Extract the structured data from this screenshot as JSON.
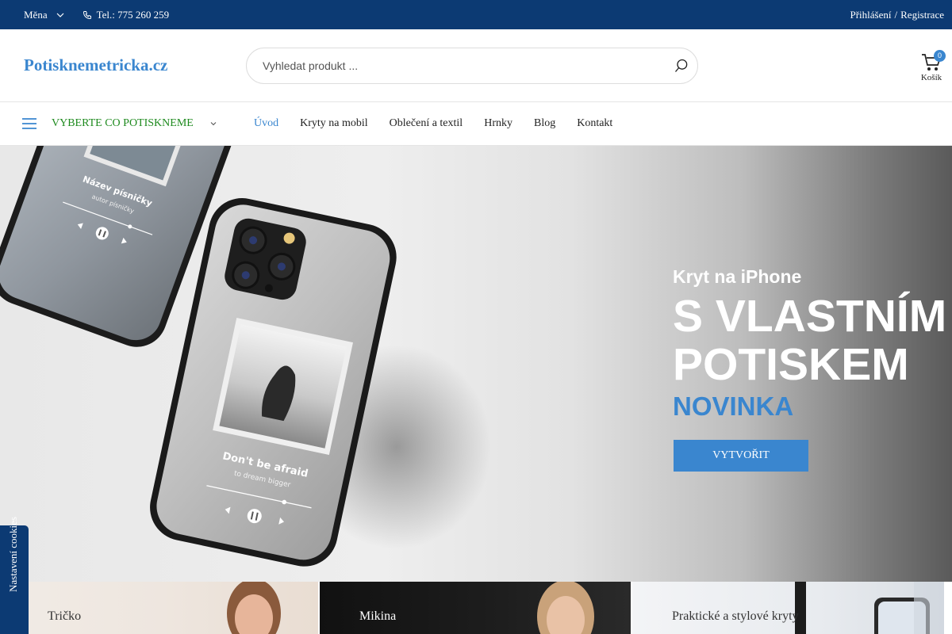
{
  "topbar": {
    "currency_label": "Měna",
    "phone_label": "Tel.: 775 260 259",
    "login_label": "Přihlášení",
    "separator": "/",
    "register_label": "Registrace"
  },
  "header": {
    "logo": "Potisknemetricka.cz",
    "search_placeholder": "Vyhledat produkt ...",
    "cart_count": "0",
    "cart_label": "Košík"
  },
  "nav": {
    "category_label": "VYBERTE CO POTISKNEME",
    "items": [
      {
        "label": "Úvod",
        "active": true
      },
      {
        "label": "Kryty na mobil"
      },
      {
        "label": "Oblečení a textil"
      },
      {
        "label": "Hrnky"
      },
      {
        "label": "Blog"
      },
      {
        "label": "Kontakt"
      }
    ]
  },
  "hero": {
    "subtitle": "Kryt na iPhone",
    "headline_line1": "S VLASTNÍM",
    "headline_line2": "POTISKEM",
    "tag": "NOVINKA",
    "button_label": "VYTVOŘIT",
    "phone_back": {
      "song": "Název písničky",
      "artist": "autor písničky"
    },
    "phone_front": {
      "song": "Don't be afraid",
      "artist": "to dream bigger"
    }
  },
  "cookie_tab_label": "Nastavení cookies",
  "cards": [
    {
      "title": "Tričko"
    },
    {
      "title": "Mikina"
    },
    {
      "title": "Praktické a stylové kryty"
    }
  ],
  "colors": {
    "topbar": "#0c3a73",
    "accent": "#3a86cf",
    "category_green": "#1e8a1e"
  }
}
